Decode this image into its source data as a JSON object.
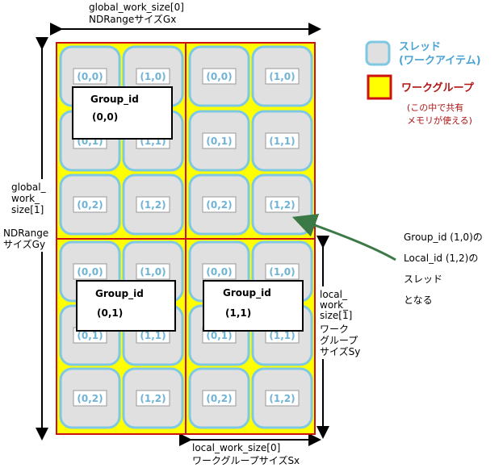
{
  "top_label": {
    "line1": "global_work_size[0]",
    "line2": "NDRangeサイズGx"
  },
  "left_label": {
    "lines": [
      "global_",
      "work_",
      "size[1]"
    ],
    "extra": [
      "NDRange",
      "サイズGy"
    ]
  },
  "right_label": {
    "lines": [
      "local_",
      "work_",
      "size[1]",
      "ワーク",
      "グループ",
      "サイズSy"
    ]
  },
  "bottom_label": {
    "line1": "local_work_size[0]",
    "line2": "ワークグループサイズSx"
  },
  "legend": {
    "thread_line1": "スレッド",
    "thread_line2": "(ワークアイテム)",
    "workgroup": "ワークグループ",
    "note_line1": "(この中で共有",
    "note_line2": "メモリが使える)"
  },
  "annotation": {
    "lines": [
      "Group_id (1,0)の",
      "Local_id (1,2)の",
      "スレッド",
      "となる"
    ]
  },
  "thread_ids": [
    [
      "(0,0)",
      "(1,0)",
      "(0,0)",
      "(1,0)"
    ],
    [
      "(0,1)",
      "(1,1)",
      "(0,1)",
      "(1,1)"
    ],
    [
      "(0,2)",
      "(1,2)",
      "(0,2)",
      "(1,2)"
    ],
    [
      "(0,0)",
      "(1,0)",
      "(0,0)",
      "(1,0)"
    ],
    [
      "(0,1)",
      "(1,1)",
      "(0,1)",
      "(1,1)"
    ],
    [
      "(0,2)",
      "(1,2)",
      "(0,2)",
      "(1,2)"
    ]
  ],
  "group_boxes": [
    {
      "title": "Group_id",
      "id": "(0,0)"
    },
    {
      "title": "Group_id",
      "id": "(0,1)"
    },
    {
      "title": "Group_id",
      "id": "(1,1)"
    }
  ],
  "colors": {
    "workgroup_fill": "#ffff00",
    "workgroup_border": "#cc1111",
    "thread_fill": "#e0e0e0",
    "thread_border": "#7ec8e3",
    "arrow": "#3b7a47"
  }
}
